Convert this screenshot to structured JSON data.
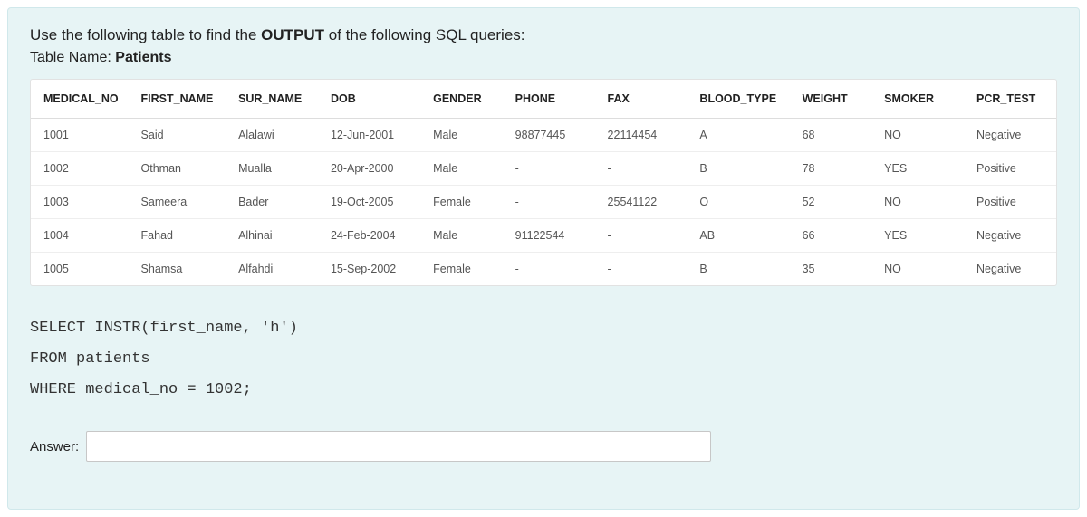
{
  "intro_prefix": "Use the following table to find the ",
  "intro_bold": "OUTPUT",
  "intro_suffix": " of the following SQL queries:",
  "table_name_prefix": "Table Name: ",
  "table_name_bold": "Patients",
  "headers": {
    "medical_no": "MEDICAL_NO",
    "first_name": "FIRST_NAME",
    "sur_name": "SUR_NAME",
    "dob": "DOB",
    "gender": "GENDER",
    "phone": "PHONE",
    "fax": "FAX",
    "blood_type": "BLOOD_TYPE",
    "weight": "WEIGHT",
    "smoker": "SMOKER",
    "pcr_test": "PCR_TEST"
  },
  "rows": [
    {
      "medical_no": "1001",
      "first_name": "Said",
      "sur_name": "Alalawi",
      "dob": "12-Jun-2001",
      "gender": "Male",
      "phone": "98877445",
      "fax": "22114454",
      "blood_type": "A",
      "weight": "68",
      "smoker": "NO",
      "pcr_test": "Negative"
    },
    {
      "medical_no": "1002",
      "first_name": "Othman",
      "sur_name": "Mualla",
      "dob": "20-Apr-2000",
      "gender": "Male",
      "phone": "-",
      "fax": "-",
      "blood_type": "B",
      "weight": "78",
      "smoker": "YES",
      "pcr_test": "Positive"
    },
    {
      "medical_no": "1003",
      "first_name": "Sameera",
      "sur_name": "Bader",
      "dob": "19-Oct-2005",
      "gender": "Female",
      "phone": "-",
      "fax": "25541122",
      "blood_type": "O",
      "weight": "52",
      "smoker": "NO",
      "pcr_test": "Positive"
    },
    {
      "medical_no": "1004",
      "first_name": "Fahad",
      "sur_name": "Alhinai",
      "dob": "24-Feb-2004",
      "gender": "Male",
      "phone": "91122544",
      "fax": "-",
      "blood_type": "AB",
      "weight": "66",
      "smoker": "YES",
      "pcr_test": "Negative"
    },
    {
      "medical_no": "1005",
      "first_name": "Shamsa",
      "sur_name": "Alfahdi",
      "dob": "15-Sep-2002",
      "gender": "Female",
      "phone": "-",
      "fax": "-",
      "blood_type": "B",
      "weight": "35",
      "smoker": "NO",
      "pcr_test": "Negative"
    }
  ],
  "sql": "SELECT INSTR(first_name, 'h')\nFROM patients\nWHERE medical_no = 1002;",
  "answer_label": "Answer:",
  "answer_value": ""
}
